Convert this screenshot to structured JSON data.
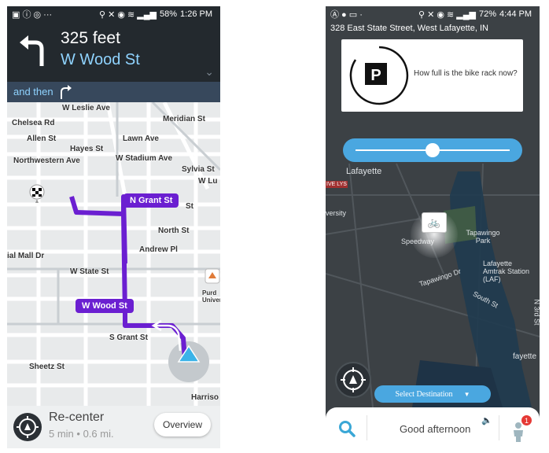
{
  "left": {
    "status": {
      "left_icons": "▣ ⓘ ◎ ···",
      "battery": "58%",
      "time": "1:26 PM"
    },
    "instruction": {
      "distance": "325 feet",
      "street": "W Wood St"
    },
    "then_label": "and then",
    "map_labels": {
      "w_leslie": "W Leslie Ave",
      "chelsea": "Chelsea Rd",
      "meridian": "Meridian St",
      "allen": "Allen St",
      "lawn": "Lawn Ave",
      "hayes": "Hayes St",
      "stadium": "W Stadium Ave",
      "northwestern": "Northwestern Ave",
      "sylvia": "Sylvia St",
      "wlu": "W Lu",
      "st": "St",
      "north": "North St",
      "andrew": "Andrew Pl",
      "mall": "ial Mall Dr",
      "wstate": "W State St",
      "sgrant": "S Grant St",
      "sheetz": "Sheetz St",
      "harriso": "Harriso",
      "purdue": "Purd Univer"
    },
    "route_badges": {
      "n_grant": "N Grant St",
      "w_wood": "W Wood St"
    },
    "recenter_label": "Re-center",
    "eta": "5 min • 0.6 mi.",
    "overview_label": "Overview"
  },
  "right": {
    "status": {
      "left_icons": "Ⓐ ● ▭ ·",
      "battery": "72%",
      "time": "4:44 PM"
    },
    "address": "328 East State Street, West Lafayette, IN",
    "prompt": "How full is the bike rack now?",
    "slider_fill": 0.5,
    "map_labels": {
      "lafayette": "Lafayette",
      "speedway": "Speedway",
      "tapawingo_park": "Tapawingo Park",
      "tapawingo_dr": "Tapawingo Dr",
      "amtrak": "Lafayette Amtrak Station (LAF)",
      "south": "South St",
      "n3rd": "N 3rd St",
      "fayette": "fayette",
      "versity": "versity",
      "ive_lys": "IVE LYS"
    },
    "select_destination": "Select Destination",
    "greeting": "Good afternoon",
    "notification_count": "1"
  },
  "colors": {
    "route": "#6b1fd1",
    "nav_header": "#23292e",
    "accent_blue": "#4aa7e0",
    "street_blue": "#8fd3ff"
  }
}
